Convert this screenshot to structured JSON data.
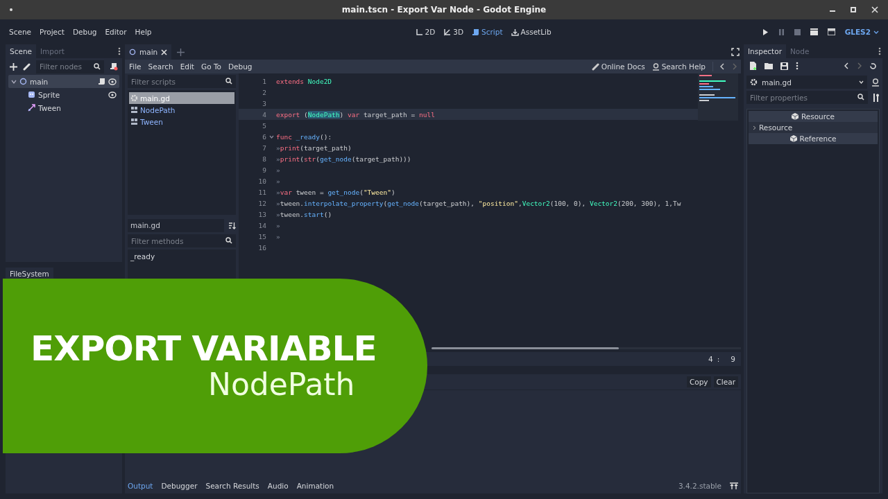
{
  "window": {
    "title": "main.tscn - Export Var Node - Godot Engine"
  },
  "menu": [
    "Scene",
    "Project",
    "Debug",
    "Editor",
    "Help"
  ],
  "workspaces": [
    {
      "label": "2D",
      "kind": "twod",
      "selected": false
    },
    {
      "label": "3D",
      "kind": "threed",
      "selected": false
    },
    {
      "label": "Script",
      "kind": "script",
      "selected": true
    },
    {
      "label": "AssetLib",
      "kind": "assetlib",
      "selected": false
    }
  ],
  "renderer": "GLES2",
  "scene_dock": {
    "tabs": [
      {
        "label": "Scene",
        "selected": true
      },
      {
        "label": "Import",
        "selected": false
      }
    ],
    "filter_placeholder": "Filter nodes",
    "tree": [
      {
        "name": "main",
        "kind": "node2d",
        "selected": true,
        "expanded": true,
        "has_script": true,
        "children": [
          {
            "name": "Sprite",
            "kind": "sprite",
            "selected": false,
            "has_script": false
          },
          {
            "name": "Tween",
            "kind": "tween",
            "selected": false,
            "has_script": false
          }
        ]
      }
    ]
  },
  "filesystem_dock": {
    "title": "FileSystem"
  },
  "editor_tabs": [
    {
      "label": "main",
      "selected": true
    }
  ],
  "script_menu": [
    "File",
    "Search",
    "Edit",
    "Go To",
    "Debug"
  ],
  "help_links": [
    {
      "label": "Online Docs",
      "kind": "link"
    },
    {
      "label": "Search Help",
      "kind": "help"
    }
  ],
  "scripts": {
    "placeholder": "Filter scripts",
    "items": [
      {
        "name": "main.gd",
        "kind": "script",
        "selected": true
      },
      {
        "name": "NodePath",
        "kind": "doc",
        "selected": false
      },
      {
        "name": "Tween",
        "kind": "doc",
        "selected": false
      }
    ]
  },
  "methods": {
    "script": "main.gd",
    "placeholder": "Filter methods",
    "items": [
      "_ready"
    ]
  },
  "code": [
    {
      "number": "1",
      "tokens": [
        {
          "kind": "keyword",
          "text": "extends "
        },
        {
          "kind": "type",
          "text": "Node2D"
        }
      ]
    },
    {
      "number": "2"
    },
    {
      "number": "3"
    },
    {
      "number": "4",
      "current": true,
      "tokens": [
        {
          "kind": "keyword",
          "text": "export"
        },
        {
          "kind": "plain",
          "text": " ("
        },
        {
          "kind": "selection",
          "text": "NodePath"
        },
        {
          "kind": "plain",
          "text": ") "
        },
        {
          "kind": "keyword",
          "text": "var"
        },
        {
          "kind": "plain",
          "text": " target_path = "
        },
        {
          "kind": "keyword",
          "text": "null"
        }
      ]
    },
    {
      "number": "5"
    },
    {
      "number": "6",
      "fold": true,
      "tokens": [
        {
          "kind": "keyword",
          "text": "func "
        },
        {
          "kind": "func",
          "text": "_ready"
        },
        {
          "kind": "plain",
          "text": "():"
        }
      ]
    },
    {
      "number": "7",
      "tokens": [
        {
          "kind": "tab",
          "text": "»"
        },
        {
          "kind": "keyword",
          "text": "print"
        },
        {
          "kind": "plain",
          "text": "(target_path)"
        }
      ]
    },
    {
      "number": "8",
      "tokens": [
        {
          "kind": "tab",
          "text": "»"
        },
        {
          "kind": "keyword",
          "text": "print"
        },
        {
          "kind": "plain",
          "text": "("
        },
        {
          "kind": "keyword",
          "text": "str"
        },
        {
          "kind": "plain",
          "text": "("
        },
        {
          "kind": "func",
          "text": "get_node"
        },
        {
          "kind": "plain",
          "text": "(target_path)))"
        }
      ]
    },
    {
      "number": "9",
      "tokens": [
        {
          "kind": "tab",
          "text": "»"
        }
      ]
    },
    {
      "number": "10",
      "tokens": [
        {
          "kind": "tab",
          "text": "»"
        }
      ]
    },
    {
      "number": "11",
      "tokens": [
        {
          "kind": "tab",
          "text": "»"
        },
        {
          "kind": "keyword",
          "text": "var"
        },
        {
          "kind": "plain",
          "text": " tween = "
        },
        {
          "kind": "func",
          "text": "get_node"
        },
        {
          "kind": "plain",
          "text": "("
        },
        {
          "kind": "string",
          "text": "\"Tween\""
        },
        {
          "kind": "plain",
          "text": ")"
        }
      ]
    },
    {
      "number": "12",
      "tokens": [
        {
          "kind": "tab",
          "text": "»"
        },
        {
          "kind": "plain",
          "text": "tween."
        },
        {
          "kind": "func",
          "text": "interpolate_property"
        },
        {
          "kind": "plain",
          "text": "("
        },
        {
          "kind": "func",
          "text": "get_node"
        },
        {
          "kind": "plain",
          "text": "(target_path), "
        },
        {
          "kind": "string",
          "text": "\"position\""
        },
        {
          "kind": "plain",
          "text": ","
        },
        {
          "kind": "type",
          "text": "Vector2"
        },
        {
          "kind": "plain",
          "text": "(100, 0), "
        },
        {
          "kind": "type",
          "text": "Vector2"
        },
        {
          "kind": "plain",
          "text": "(200, 300), 1,Tw"
        }
      ]
    },
    {
      "number": "13",
      "tokens": [
        {
          "kind": "tab",
          "text": "»"
        },
        {
          "kind": "plain",
          "text": "tween."
        },
        {
          "kind": "func",
          "text": "start"
        },
        {
          "kind": "plain",
          "text": "()"
        }
      ]
    },
    {
      "number": "14",
      "tokens": [
        {
          "kind": "tab",
          "text": "»"
        }
      ]
    },
    {
      "number": "15",
      "tokens": [
        {
          "kind": "tab",
          "text": "»"
        }
      ]
    },
    {
      "number": "16"
    }
  ],
  "cursor": {
    "line": "4",
    "separator": ":",
    "column": "9"
  },
  "output": {
    "buttons": [
      "Copy",
      "Clear"
    ]
  },
  "bottom_tabs": [
    {
      "label": "Output",
      "selected": true
    },
    {
      "label": "Debugger",
      "selected": false
    },
    {
      "label": "Search Results",
      "selected": false
    },
    {
      "label": "Audio",
      "selected": false
    },
    {
      "label": "Animation",
      "selected": false
    }
  ],
  "version": "3.4.2.stable",
  "inspector": {
    "tabs": [
      {
        "label": "Inspector",
        "selected": true
      },
      {
        "label": "Node",
        "selected": false
      }
    ],
    "resource": "main.gd",
    "placeholder": "Filter properties",
    "sections": [
      {
        "label": "Resource",
        "kind": "category"
      },
      {
        "label": "Resource",
        "kind": "group"
      },
      {
        "label": "Reference",
        "kind": "category"
      }
    ]
  },
  "banner": {
    "title": "EXPORT VARIABLE",
    "subtitle": "NodePath"
  }
}
